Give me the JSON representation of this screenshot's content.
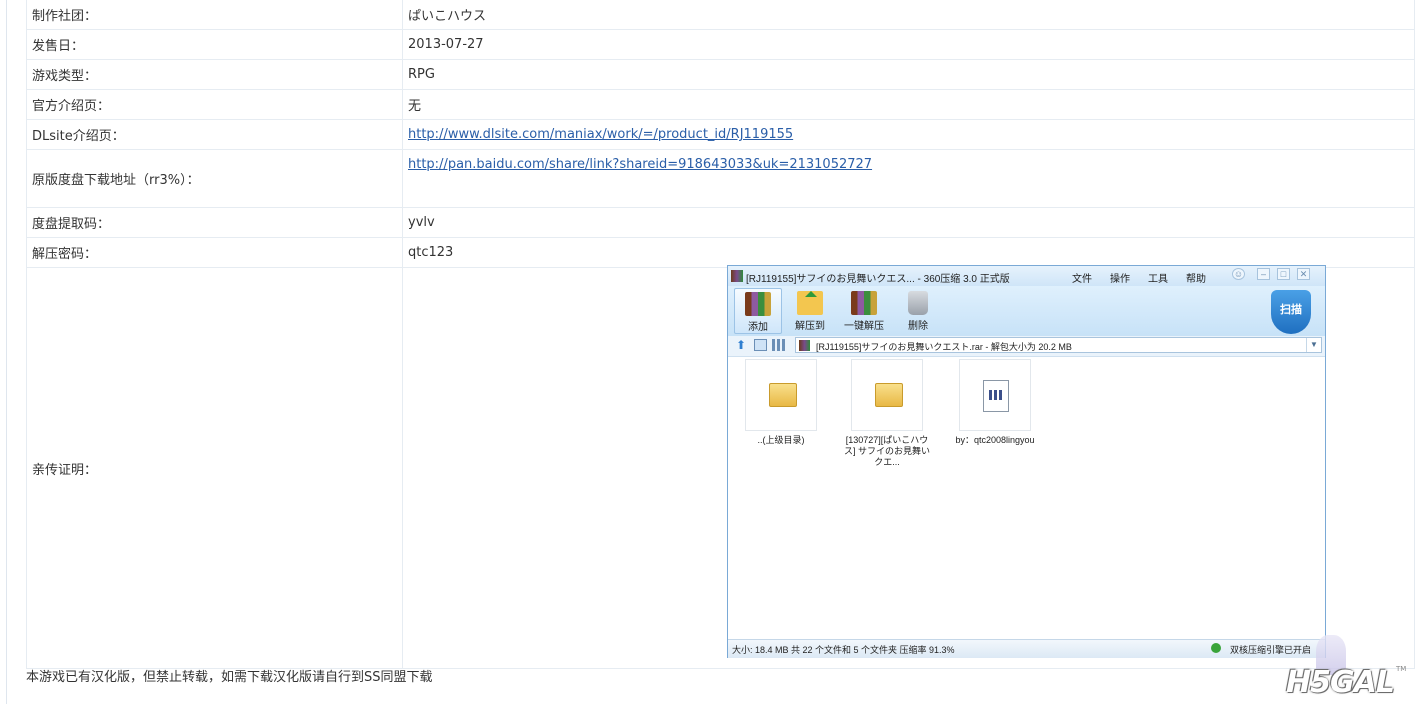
{
  "rows": [
    {
      "label": "制作社团：",
      "value": "ぱいこハウス"
    },
    {
      "label": "发售日：",
      "value": "2013-07-27"
    },
    {
      "label": "游戏类型：",
      "value": "RPG"
    },
    {
      "label": "官方介绍页：",
      "value": "无"
    },
    {
      "label": "DLsite介绍页：",
      "value": "http://www.dlsite.com/maniax/work/=/product_id/RJ119155"
    },
    {
      "label": "原版度盘下载地址（rr3%）：",
      "value": "http://pan.baidu.com/share/link?shareid=918643033&uk=2131052727"
    },
    {
      "label": "度盘提取码：",
      "value": "yvlv"
    },
    {
      "label": "解压密码：",
      "value": "qtc123"
    },
    {
      "label": "亲传证明：",
      "value": ""
    }
  ],
  "note": "本游戏已有汉化版，但禁止转载，如需下载汉化版请自行到SS同盟下载",
  "zip_window": {
    "title": "[RJ119155]サフイのお見舞いクエス... - 360压缩 3.0 正式版",
    "menu": [
      "文件",
      "操作",
      "工具",
      "帮助"
    ],
    "toolbar": [
      "添加",
      "解压到",
      "一键解压",
      "删除"
    ],
    "scan_label": "扫描",
    "address": "[RJ119155]サフイのお見舞いクエスト.rar - 解包大小为 20.2 MB",
    "items": [
      {
        "label": "..(上级目录)",
        "icon": "folder-icon"
      },
      {
        "label": "[130727][ぱいこハウス] サフイのお見舞いクエ...",
        "icon": "folder-icon"
      },
      {
        "label": "by：qtc2008lingyou",
        "icon": "document-icon"
      }
    ],
    "status_left": "大小: 18.4 MB 共 22 个文件和 5 个文件夹 压缩率 91.3%",
    "status_right": "双核压缩引擎已开启"
  },
  "watermark": {
    "text": "H5GAL",
    "tm": "TM"
  }
}
